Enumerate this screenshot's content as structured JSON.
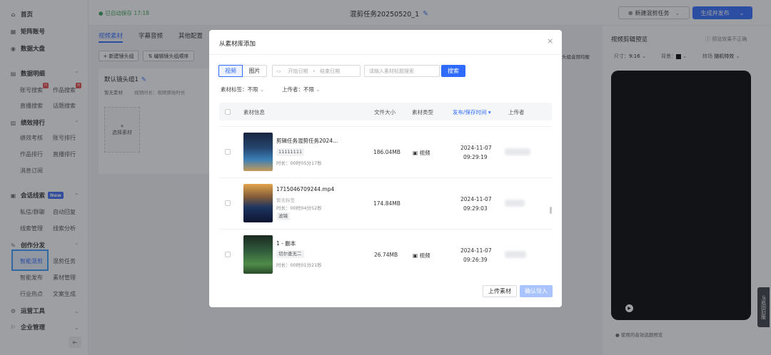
{
  "sidebar": {
    "home": "首页",
    "matrix": "矩阵账号",
    "dashboard": "数据大盘",
    "data_detail": {
      "label": "数据明细",
      "items": [
        "账号搜索",
        "作品搜索",
        "直播搜索",
        "话题搜索"
      ],
      "hot": "H"
    },
    "performance": {
      "label": "绩效排行",
      "items": [
        "绩效考核",
        "账号排行",
        "作品排行",
        "直播排行",
        "消息订阅"
      ]
    },
    "leads": {
      "label": "会话线索",
      "badge": "New",
      "items": [
        "私信/群聊",
        "自动回复",
        "线索管理",
        "线索分析"
      ]
    },
    "creation": {
      "label": "创作分发",
      "items": [
        "智能混剪",
        "混剪任务",
        "智能发布",
        "素材管理",
        "行业热点",
        "文案生成"
      ]
    },
    "ops": "运营工具",
    "enterprise": "企业管理"
  },
  "header": {
    "autosave": "已自动保存 17:18",
    "title": "混剪任务20250520_1",
    "new_task": "新建混剪任务",
    "publish": "生成并发布"
  },
  "editor": {
    "tabs": [
      "视频素材",
      "字幕音频",
      "其他配置"
    ],
    "add_shot": "+ 新建镜头组",
    "edit_order": "编辑镜头组顺序",
    "group_title": "默认镜头组1",
    "no_material": "暂无素材",
    "duration_label": "视频时长：视频原始时长",
    "select_material": "选择素材",
    "right_hint": "头组音频均衡"
  },
  "preview": {
    "title": "视频剪辑预览",
    "hint": "预览效果不正确",
    "size_label": "尺寸：",
    "size": "9:16",
    "bg_label": "背景：",
    "transition_label": "转场",
    "transition": "随机特效",
    "footer": "使用的音效选题预览"
  },
  "side_float": "返回旧版",
  "modal": {
    "title": "从素材库添加",
    "types": [
      "视频",
      "图片"
    ],
    "start_date": "开始日期",
    "dash": "-",
    "end_date": "结束日期",
    "search_placeholder": "请输入素材标题搜索",
    "search_btn": "搜索",
    "filter_tag": "素材标签：",
    "filter_tag_val": "不限",
    "filter_uploader": "上传者：",
    "filter_uploader_val": "不限",
    "columns": [
      "素材信息",
      "文件大小",
      "素材类型",
      "发布/保存时间",
      "上传者"
    ],
    "rows": [
      {
        "name": "剪辑任务混剪任务2024...",
        "tag": "11111111",
        "duration": "时长：00时05分17秒",
        "size": "186.04MB",
        "type": "视频",
        "date": "2024-11-07",
        "time": "09:29:19"
      },
      {
        "name": "1715046709244.mp4",
        "sub": "暂无标签",
        "duration": "时长：00时04分52秒",
        "tag": "滤镜",
        "size": "174.84MB",
        "type": "视频",
        "date": "2024-11-07",
        "time": "09:29:03"
      },
      {
        "name": "1 - 副本",
        "tag": "切尔查无二",
        "duration": "时长：00时01分21秒",
        "size": "26.74MB",
        "type": "视频",
        "date": "2024-11-07",
        "time": "09:26:39"
      }
    ],
    "upload_btn": "上传素材",
    "confirm_btn": "确认导入"
  }
}
